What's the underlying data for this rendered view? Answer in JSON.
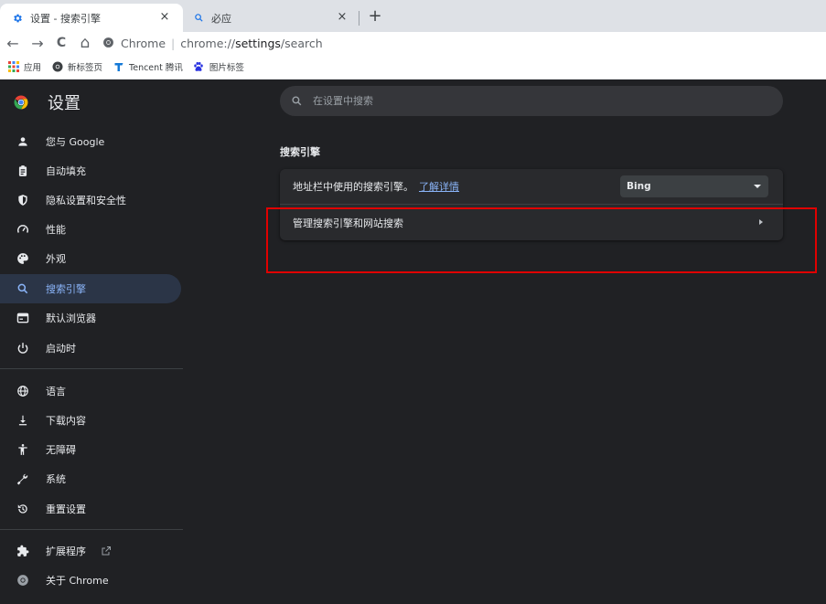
{
  "tabs": [
    {
      "label": "设置 - 搜索引擎",
      "close": "×"
    },
    {
      "label": "必应",
      "close": "×"
    }
  ],
  "new_tab": "+",
  "toolbar": {
    "back": "←",
    "forward": "→",
    "reload": "C",
    "home": "⌂",
    "site_label": "Chrome",
    "separator": "|",
    "url_scheme": "chrome://",
    "url_host": "settings",
    "url_path": "/search"
  },
  "bookmarks": [
    {
      "label": "应用",
      "icon": "apps-grid-icon"
    },
    {
      "label": "新标签页",
      "icon": "chrome-icon"
    },
    {
      "label": "Tencent 腾讯",
      "icon": "tencent-icon"
    },
    {
      "label": "图片标签",
      "icon": "baidu-paw-icon"
    }
  ],
  "settings": {
    "title": "设置",
    "search_placeholder": "在设置中搜索",
    "section_title": "搜索引擎",
    "address_bar_label": "地址栏中使用的搜索引擎。",
    "learn_more": "了解详情",
    "engine_selected": "Bing",
    "manage_label": "管理搜索引擎和网站搜索"
  },
  "nav": [
    {
      "label": "您与 Google",
      "icon": "person-icon"
    },
    {
      "label": "自动填充",
      "icon": "clipboard-icon"
    },
    {
      "label": "隐私设置和安全性",
      "icon": "shield-icon"
    },
    {
      "label": "性能",
      "icon": "speedometer-icon"
    },
    {
      "label": "外观",
      "icon": "palette-icon"
    },
    {
      "label": "搜索引擎",
      "icon": "search-icon"
    },
    {
      "label": "默认浏览器",
      "icon": "browser-window-icon"
    },
    {
      "label": "启动时",
      "icon": "power-icon"
    },
    {
      "label": "语言",
      "icon": "globe-icon"
    },
    {
      "label": "下载内容",
      "icon": "download-icon"
    },
    {
      "label": "无障碍",
      "icon": "accessibility-icon"
    },
    {
      "label": "系统",
      "icon": "wrench-icon"
    },
    {
      "label": "重置设置",
      "icon": "restore-icon"
    },
    {
      "label": "扩展程序",
      "icon": "puzzle-icon"
    },
    {
      "label": "关于 Chrome",
      "icon": "chrome-icon"
    }
  ],
  "colors": {
    "accent": "#8ab4f8",
    "selected_bg": "#2b3547",
    "highlight_border": "#e00000",
    "page_bg": "#202124"
  }
}
